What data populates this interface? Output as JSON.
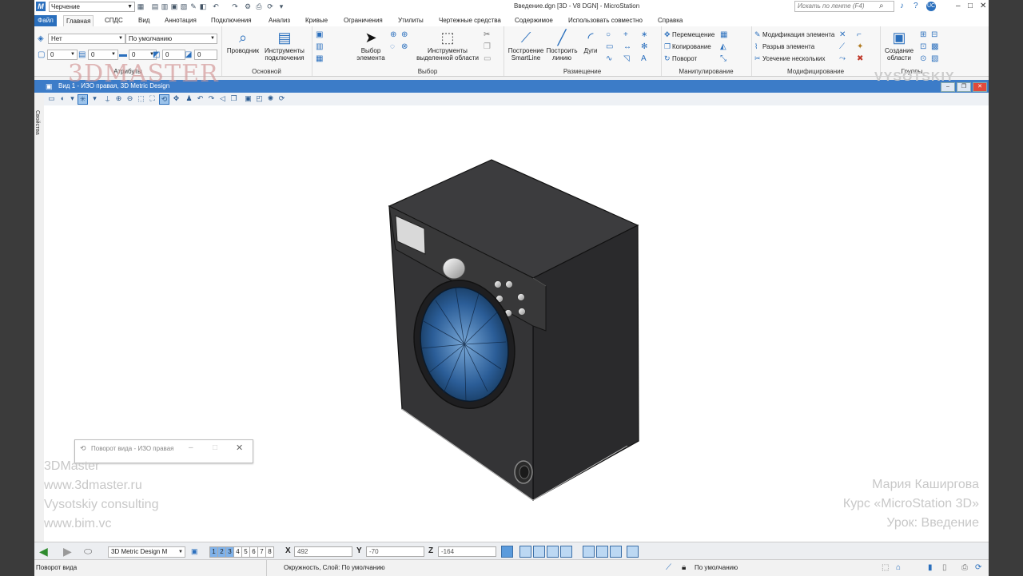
{
  "window": {
    "workspace": "Черчение",
    "title": "Введение.dgn [3D - V8 DGN] - MicroStation",
    "search_placeholder": "Искать по ленте (F4)",
    "user_badge": "UC"
  },
  "tabs": [
    "Файл",
    "Главная",
    "СПДС",
    "Вид",
    "Аннотация",
    "Подключения",
    "Анализ",
    "Кривые",
    "Ограничения",
    "Утилиты",
    "Чертежные средства",
    "Содержимое",
    "Использовать совместно",
    "Справка"
  ],
  "ribbon": {
    "attributes": {
      "label": "Атрибуты",
      "level": "Нет",
      "style": "По умолчанию",
      "color": "0",
      "weight": "0",
      "linestyle": "0",
      "transparency": "0",
      "priority": "0"
    },
    "primary": {
      "label": "Основной",
      "explorer": "Проводник",
      "attach_tools": "Инструменты подключения"
    },
    "selection": {
      "label": "Выбор",
      "select_element": "Выбор элемента",
      "selection_tools": "Инструменты выделенной области"
    },
    "placement": {
      "label": "Размещение",
      "smartline": "Построение SmartLine",
      "line": "Построить линию",
      "arcs": "Дуги"
    },
    "manipulate": {
      "label": "Манипулирование",
      "move": "Перемещение",
      "copy": "Копирование",
      "rotate": "Поворот"
    },
    "modify": {
      "label": "Модифицирование",
      "modify_element": "Модификация элемента",
      "break_element": "Разрыв элемента",
      "trim_multiple": "Усечение нескольких"
    },
    "groups": {
      "label": "Группы",
      "create_region": "Создание области"
    }
  },
  "view": {
    "title": "Вид 1 - ИЗО правая, 3D Metric Design",
    "properties_tab": "Свойства",
    "rotate_dialog_title": "Поворот вида - ИЗО правая"
  },
  "watermark": {
    "brand": "3DMASTER",
    "left_lines": [
      "3DMaster",
      "www.3dmaster.ru",
      "Vysotskiy consulting",
      "www.bim.vc"
    ],
    "right_lines": [
      "Мария Каширгова",
      "Курс «MicroStation 3D»",
      "Урок: Введение"
    ],
    "vc_logo": "VYSOTSKIY"
  },
  "bottom": {
    "model": "3D Metric Design M",
    "view_numbers": [
      "1",
      "2",
      "3",
      "4",
      "5",
      "6",
      "7",
      "8"
    ],
    "active_views": [
      "1",
      "2",
      "3"
    ],
    "x_label": "X",
    "x": "492",
    "y_label": "Y",
    "y": "-70",
    "z_label": "Z",
    "z": "-164"
  },
  "status": {
    "prompt": "Поворот вида",
    "message": "Окружность, Слой: По умолчанию",
    "snap": "По умолчанию"
  },
  "colors": {
    "accent": "#2a6fbd",
    "view_title": "#3c7cc8"
  }
}
